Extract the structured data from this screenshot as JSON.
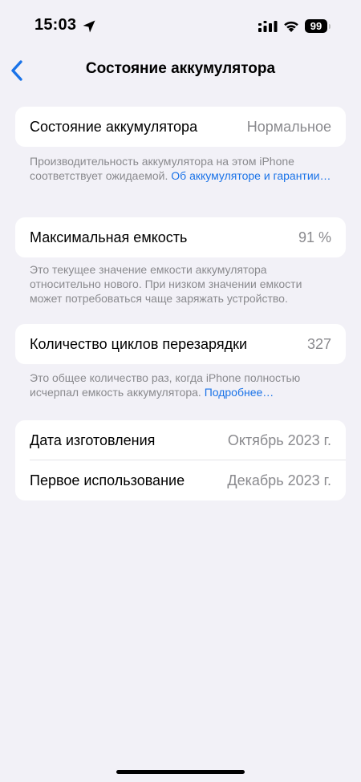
{
  "status_bar": {
    "time": "15:03",
    "battery_level": "99",
    "icons": [
      "location-arrow-icon",
      "signal-icon",
      "wifi-icon",
      "battery-icon"
    ]
  },
  "nav": {
    "title": "Состояние аккумулятора",
    "back_icon": "chevron-left-icon",
    "accent_color": "#1a73e8"
  },
  "battery_status": {
    "label": "Состояние аккумулятора",
    "value": "Нормальное",
    "footnote_text": "Производительность аккумулятора на этом iPhone соответствует ожидаемой. ",
    "footnote_link": "Об аккумуляторе и гарантии…"
  },
  "max_capacity": {
    "label": "Максимальная емкость",
    "value": "91 %",
    "footnote_text": "Это текущее значение емкости аккумулятора относительно нового. При низком значении емкости может потребоваться чаще заряжать устройство."
  },
  "cycle_count": {
    "label": "Количество циклов перезарядки",
    "value": "327",
    "footnote_text": "Это общее количество раз, когда iPhone полностью исчерпал емкость аккумулятора. ",
    "footnote_link": "Подробнее…"
  },
  "dates": {
    "manufacture_label": "Дата изготовления",
    "manufacture_value": "Октябрь 2023 г.",
    "first_use_label": "Первое использование",
    "first_use_value": "Декабрь 2023 г."
  }
}
